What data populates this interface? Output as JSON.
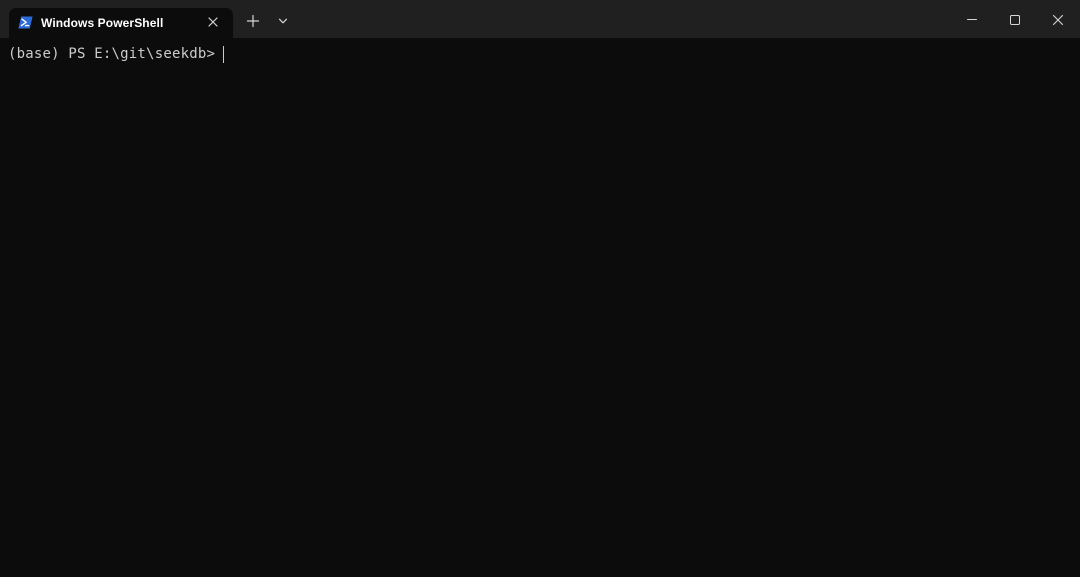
{
  "window": {
    "tab": {
      "title": "Windows PowerShell",
      "icon": "powershell-icon"
    },
    "controls": {
      "new_tab_icon": "plus-icon",
      "dropdown_icon": "chevron-down-icon",
      "minimize_icon": "minimize-icon",
      "maximize_icon": "maximize-icon",
      "close_icon": "close-icon"
    },
    "colors": {
      "titlebar": "#202020",
      "terminal_bg": "#0c0c0c",
      "text": "#cccccc",
      "powershell_blue": "#2d6bd9"
    }
  },
  "terminal": {
    "prompt": "(base) PS E:\\git\\seekdb>"
  }
}
